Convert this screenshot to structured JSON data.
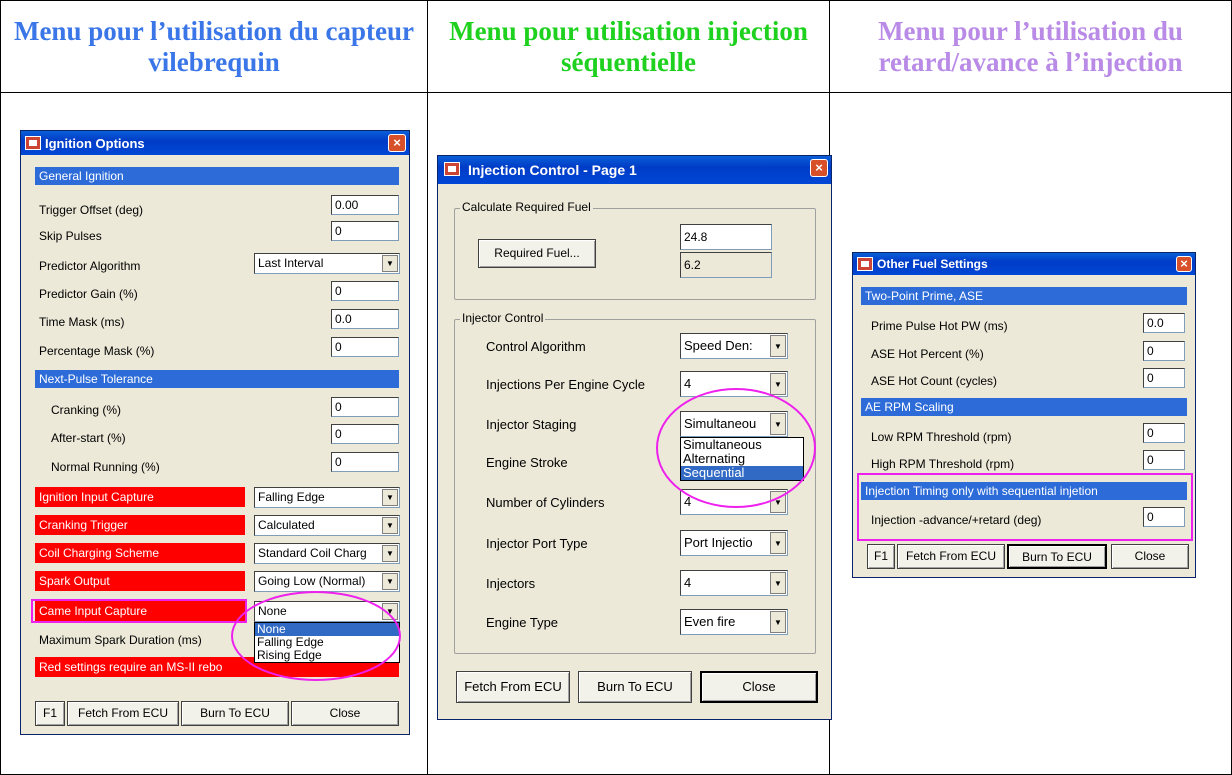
{
  "columns": [
    {
      "title": "Menu pour l’utilisation du capteur vilebrequin",
      "color": "#3a76e8"
    },
    {
      "title": "Menu pour utilisation injection séquentielle",
      "color": "#1fd11f"
    },
    {
      "title": "Menu pour l’utilisation du retard/avance à l’injection",
      "color": "#b98be6"
    }
  ],
  "ignition": {
    "title": "Ignition Options",
    "general_header": "General Ignition",
    "trigger_offset": {
      "label": "Trigger Offset (deg)",
      "value": "0.00"
    },
    "skip_pulses": {
      "label": "Skip Pulses",
      "value": "0"
    },
    "predictor_algorithm": {
      "label": "Predictor Algorithm",
      "value": "Last Interval"
    },
    "predictor_gain": {
      "label": "Predictor Gain (%)",
      "value": "0"
    },
    "time_mask": {
      "label": "Time Mask (ms)",
      "value": "0.0"
    },
    "percentage_mask": {
      "label": "Percentage Mask (%)",
      "value": "0"
    },
    "tolerance_header": "Next-Pulse Tolerance",
    "cranking": {
      "label": "Cranking (%)",
      "value": "0"
    },
    "after_start": {
      "label": "After-start (%)",
      "value": "0"
    },
    "normal_running": {
      "label": "Normal Running (%)",
      "value": "0"
    },
    "ignition_input_capture": {
      "label": "Ignition Input Capture",
      "value": "Falling Edge"
    },
    "cranking_trigger": {
      "label": "Cranking Trigger",
      "value": "Calculated"
    },
    "coil_charging": {
      "label": "Coil Charging Scheme",
      "value": "Standard Coil Charg"
    },
    "spark_output": {
      "label": "Spark Output",
      "value": "Going Low (Normal)"
    },
    "came_input_capture": {
      "label": "Came Input Capture",
      "value": "None"
    },
    "max_spark": {
      "label": "Maximum Spark Duration (ms)"
    },
    "red_note": "Red settings require an MS-II rebo",
    "dropdown_options": [
      "None",
      "Falling Edge",
      "Rising Edge"
    ],
    "buttons": {
      "f1": "F1",
      "fetch": "Fetch From ECU",
      "burn": "Burn To ECU",
      "close": "Close"
    }
  },
  "injection": {
    "title": "Injection Control - Page 1",
    "calc_group": "Calculate Required Fuel",
    "required_fuel_button": "Required Fuel...",
    "req_fuel_value": "24.8",
    "req_fuel_value2": "6.2",
    "injector_group": "Injector Control",
    "control_algorithm": {
      "label": "Control Algorithm",
      "value": "Speed Den:"
    },
    "injections_per_cycle": {
      "label": "Injections Per Engine Cycle",
      "value": "4"
    },
    "injector_staging": {
      "label": "Injector Staging",
      "value": "Simultaneou"
    },
    "engine_stroke": {
      "label": "Engine Stroke"
    },
    "num_cylinders": {
      "label": "Number of Cylinders",
      "value": "4"
    },
    "port_type": {
      "label": "Injector Port Type",
      "value": "Port Injectio"
    },
    "injectors": {
      "label": "Injectors",
      "value": "4"
    },
    "engine_type": {
      "label": "Engine Type",
      "value": "Even fire"
    },
    "dropdown_options": [
      "Simultaneous",
      "Alternating",
      "Sequential"
    ],
    "buttons": {
      "fetch": "Fetch From ECU",
      "burn": "Burn To ECU",
      "close": "Close"
    }
  },
  "fuel": {
    "title": "Other Fuel Settings",
    "prime_header": "Two-Point Prime, ASE",
    "prime_pulse": {
      "label": "Prime Pulse Hot PW (ms)",
      "value": "0.0"
    },
    "ase_percent": {
      "label": "ASE Hot Percent (%)",
      "value": "0"
    },
    "ase_count": {
      "label": "ASE Hot Count (cycles)",
      "value": "0"
    },
    "ae_header": "AE RPM Scaling",
    "low_rpm": {
      "label": "Low RPM Threshold (rpm)",
      "value": "0"
    },
    "high_rpm": {
      "label": "High RPM Threshold (rpm)",
      "value": "0"
    },
    "timing_header": "Injection Timing only with sequential injetion",
    "inj_advance": {
      "label": "Injection -advance/+retard (deg)",
      "value": "0"
    },
    "buttons": {
      "f1": "F1",
      "fetch": "Fetch From ECU",
      "burn": "Burn To ECU",
      "close": "Close"
    }
  }
}
